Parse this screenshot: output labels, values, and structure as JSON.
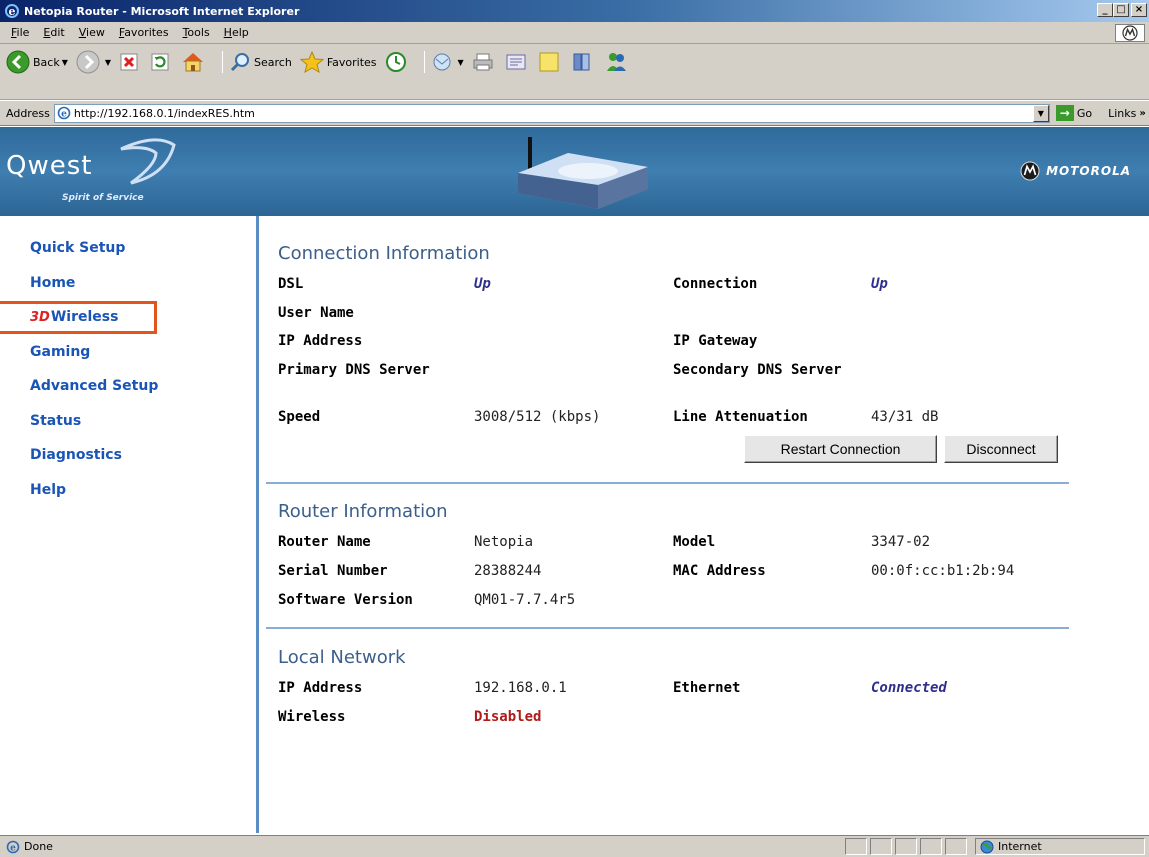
{
  "window": {
    "title": "Netopia Router - Microsoft Internet Explorer",
    "controls": {
      "minimize": "_",
      "maximize": "□",
      "close": "×"
    }
  },
  "menu": [
    "File",
    "Edit",
    "View",
    "Favorites",
    "Tools",
    "Help"
  ],
  "toolbar": {
    "back": "Back",
    "search": "Search",
    "favorites": "Favorites"
  },
  "address": {
    "label": "Address",
    "url": "http://192.168.0.1/indexRES.htm",
    "go": "Go",
    "links": "Links"
  },
  "banner": {
    "brand": "Qwest",
    "tagline": "Spirit of Service",
    "partner": "MOTOROLA"
  },
  "nav": [
    {
      "label": "Quick Setup"
    },
    {
      "label": "Home"
    },
    {
      "label": "Wireless",
      "badge": "3D"
    },
    {
      "label": "Gaming"
    },
    {
      "label": "Advanced Setup"
    },
    {
      "label": "Status"
    },
    {
      "label": "Diagnostics"
    },
    {
      "label": "Help"
    }
  ],
  "connection": {
    "title": "Connection Information",
    "dsl_label": "DSL",
    "dsl_value": "Up",
    "connection_label": "Connection",
    "connection_value": "Up",
    "username_label": "User Name",
    "ip_label": "IP Address",
    "gateway_label": "IP Gateway",
    "primary_dns_label": "Primary DNS Server",
    "secondary_dns_label": "Secondary DNS Server",
    "speed_label": "Speed",
    "speed_value": "3008/512 (kbps)",
    "attenuation_label": "Line Attenuation",
    "attenuation_value": "43/31 dB",
    "restart_button": "Restart Connection",
    "disconnect_button": "Disconnect"
  },
  "router": {
    "title": "Router Information",
    "name_label": "Router Name",
    "name_value": "Netopia",
    "model_label": "Model",
    "model_value": "3347-02",
    "serial_label": "Serial Number",
    "serial_value": "28388244",
    "mac_label": "MAC Address",
    "mac_value": "00:0f:cc:b1:2b:94",
    "software_label": "Software Version",
    "software_value": "QM01-7.7.4r5"
  },
  "local": {
    "title": "Local Network",
    "ip_label": "IP Address",
    "ip_value": "192.168.0.1",
    "ethernet_label": "Ethernet",
    "ethernet_value": "Connected",
    "wireless_label": "Wireless",
    "wireless_value": "Disabled"
  },
  "status": {
    "text": "Done",
    "zone": "Internet"
  },
  "colors": {
    "nav_link": "#1a55b5",
    "highlight": "#e3541c",
    "banner": "#3f7eb0",
    "disabled": "#b01a1a"
  }
}
